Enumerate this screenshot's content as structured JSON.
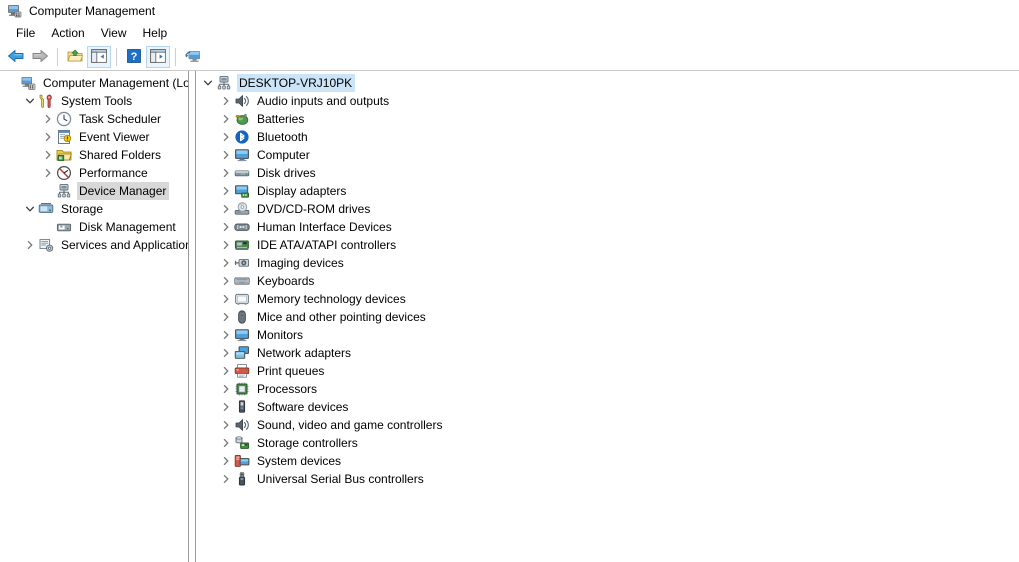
{
  "window": {
    "title": "Computer Management",
    "icon": "computer-management-icon"
  },
  "menubar": {
    "items": [
      {
        "label": "File",
        "name": "menu-file"
      },
      {
        "label": "Action",
        "name": "menu-action"
      },
      {
        "label": "View",
        "name": "menu-view"
      },
      {
        "label": "Help",
        "name": "menu-help"
      }
    ]
  },
  "toolbar": {
    "buttons": [
      {
        "name": "back-button",
        "icon": "back-arrow-icon",
        "label": "Back"
      },
      {
        "name": "forward-button",
        "icon": "forward-arrow-icon",
        "label": "Forward"
      },
      {
        "name": "up-one-level-button",
        "icon": "folder-up-icon",
        "label": "Up One Level"
      },
      {
        "name": "show-hide-tree-button",
        "icon": "show-hide-console-tree-icon",
        "label": "Show/Hide Console Tree"
      },
      {
        "name": "help-button",
        "icon": "help-question-icon",
        "label": "Help"
      },
      {
        "name": "properties-button",
        "icon": "properties-icon",
        "label": "Properties"
      },
      {
        "name": "scan-hardware-button",
        "icon": "display-console-icon",
        "label": "Scan for hardware changes"
      }
    ]
  },
  "console_tree": {
    "items": [
      {
        "label": "Computer Management (Local",
        "icon": "computer-management-icon",
        "depth": 0,
        "twisty": "none",
        "selected": "none"
      },
      {
        "label": "System Tools",
        "icon": "system-tools-icon",
        "depth": 1,
        "twisty": "expanded",
        "selected": "none"
      },
      {
        "label": "Task Scheduler",
        "icon": "clock-icon",
        "depth": 2,
        "twisty": "collapsed",
        "selected": "none"
      },
      {
        "label": "Event Viewer",
        "icon": "event-viewer-icon",
        "depth": 2,
        "twisty": "collapsed",
        "selected": "none"
      },
      {
        "label": "Shared Folders",
        "icon": "shared-folders-icon",
        "depth": 2,
        "twisty": "collapsed",
        "selected": "none"
      },
      {
        "label": "Performance",
        "icon": "performance-icon",
        "depth": 2,
        "twisty": "collapsed",
        "selected": "none"
      },
      {
        "label": "Device Manager",
        "icon": "device-manager-icon",
        "depth": 2,
        "twisty": "none",
        "selected": "gray"
      },
      {
        "label": "Storage",
        "icon": "storage-icon",
        "depth": 1,
        "twisty": "expanded",
        "selected": "none"
      },
      {
        "label": "Disk Management",
        "icon": "disk-management-icon",
        "depth": 2,
        "twisty": "none",
        "selected": "none"
      },
      {
        "label": "Services and Applications",
        "icon": "services-applications-icon",
        "depth": 1,
        "twisty": "collapsed",
        "selected": "none"
      }
    ]
  },
  "device_tree": {
    "items": [
      {
        "label": "DESKTOP-VRJ10PK",
        "icon": "computer-node-icon",
        "depth": 0,
        "twisty": "expanded",
        "selected": "blue"
      },
      {
        "label": "Audio inputs and outputs",
        "icon": "speaker-icon",
        "depth": 1,
        "twisty": "collapsed",
        "selected": "none"
      },
      {
        "label": "Batteries",
        "icon": "battery-icon",
        "depth": 1,
        "twisty": "collapsed",
        "selected": "none"
      },
      {
        "label": "Bluetooth",
        "icon": "bluetooth-icon",
        "depth": 1,
        "twisty": "collapsed",
        "selected": "none"
      },
      {
        "label": "Computer",
        "icon": "monitor-icon",
        "depth": 1,
        "twisty": "collapsed",
        "selected": "none"
      },
      {
        "label": "Disk drives",
        "icon": "disk-drive-icon",
        "depth": 1,
        "twisty": "collapsed",
        "selected": "none"
      },
      {
        "label": "Display adapters",
        "icon": "display-adapter-icon",
        "depth": 1,
        "twisty": "collapsed",
        "selected": "none"
      },
      {
        "label": "DVD/CD-ROM drives",
        "icon": "optical-drive-icon",
        "depth": 1,
        "twisty": "collapsed",
        "selected": "none"
      },
      {
        "label": "Human Interface Devices",
        "icon": "hid-icon",
        "depth": 1,
        "twisty": "collapsed",
        "selected": "none"
      },
      {
        "label": "IDE ATA/ATAPI controllers",
        "icon": "ide-controller-icon",
        "depth": 1,
        "twisty": "collapsed",
        "selected": "none"
      },
      {
        "label": "Imaging devices",
        "icon": "imaging-device-icon",
        "depth": 1,
        "twisty": "collapsed",
        "selected": "none"
      },
      {
        "label": "Keyboards",
        "icon": "keyboard-icon",
        "depth": 1,
        "twisty": "collapsed",
        "selected": "none"
      },
      {
        "label": "Memory technology devices",
        "icon": "memory-device-icon",
        "depth": 1,
        "twisty": "collapsed",
        "selected": "none"
      },
      {
        "label": "Mice and other pointing devices",
        "icon": "mouse-icon",
        "depth": 1,
        "twisty": "collapsed",
        "selected": "none"
      },
      {
        "label": "Monitors",
        "icon": "monitor-icon",
        "depth": 1,
        "twisty": "collapsed",
        "selected": "none"
      },
      {
        "label": "Network adapters",
        "icon": "network-adapter-icon",
        "depth": 1,
        "twisty": "collapsed",
        "selected": "none"
      },
      {
        "label": "Print queues",
        "icon": "printer-icon",
        "depth": 1,
        "twisty": "collapsed",
        "selected": "none"
      },
      {
        "label": "Processors",
        "icon": "processor-icon",
        "depth": 1,
        "twisty": "collapsed",
        "selected": "none"
      },
      {
        "label": "Software devices",
        "icon": "software-device-icon",
        "depth": 1,
        "twisty": "collapsed",
        "selected": "none"
      },
      {
        "label": "Sound, video and game controllers",
        "icon": "speaker-icon",
        "depth": 1,
        "twisty": "collapsed",
        "selected": "none"
      },
      {
        "label": "Storage controllers",
        "icon": "storage-controller-icon",
        "depth": 1,
        "twisty": "collapsed",
        "selected": "none"
      },
      {
        "label": "System devices",
        "icon": "system-device-icon",
        "depth": 1,
        "twisty": "collapsed",
        "selected": "none"
      },
      {
        "label": "Universal Serial Bus controllers",
        "icon": "usb-icon",
        "depth": 1,
        "twisty": "collapsed",
        "selected": "none"
      }
    ]
  },
  "colors": {
    "selection_active": "#cce4f7",
    "selection_inactive": "#d8d8d8",
    "border": "#9a9a9a",
    "toolbar_frame": "#b8d6f0",
    "accent_blue": "#2f78c4"
  }
}
